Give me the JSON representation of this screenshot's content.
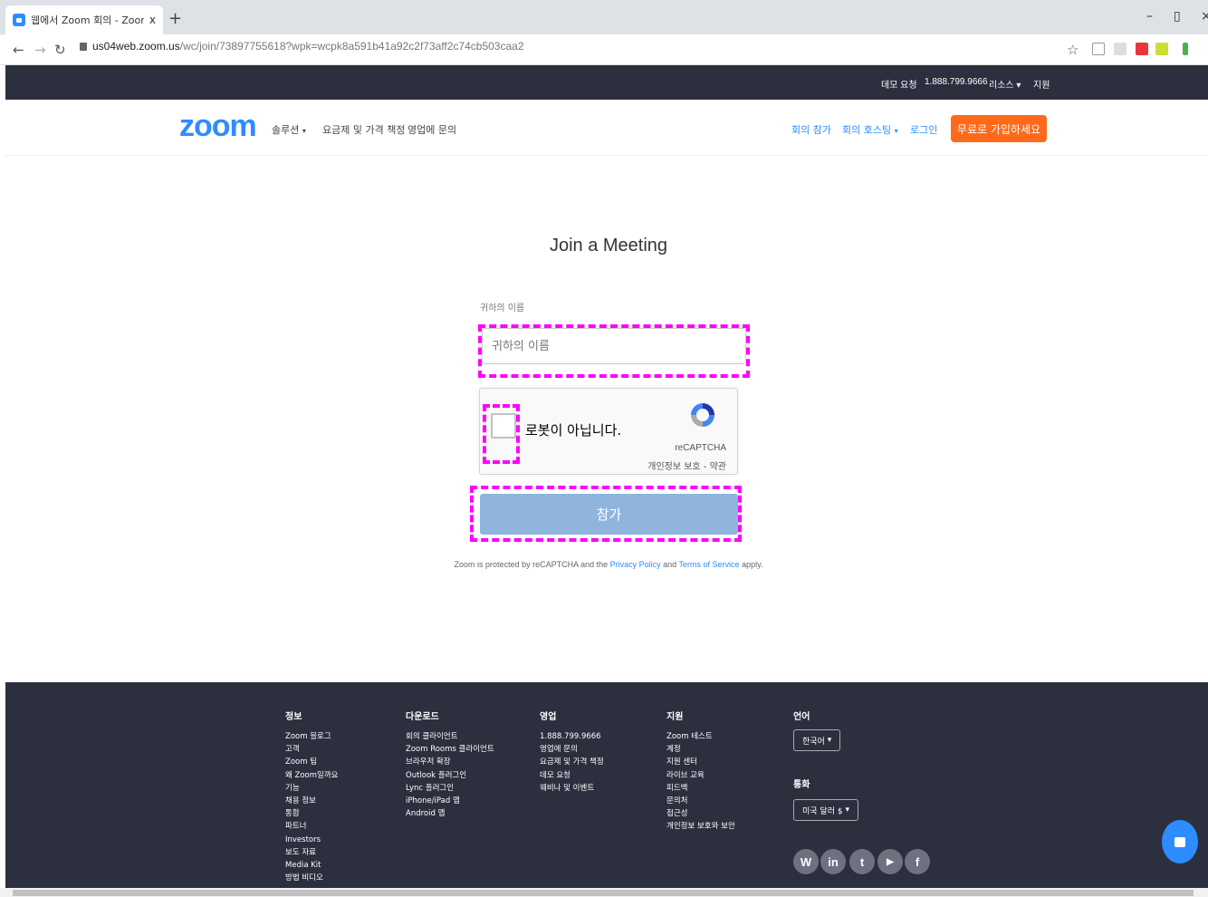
{
  "browser": {
    "tab_title": "웹에서 Zoom 회의 - Zoom",
    "tab_close": "x",
    "new_tab": "+",
    "url_host": "us04web.zoom.us",
    "url_path": "/wc/join/73897755618?wpk=wcpk8a591b41a92c2f73aff2c74cb503caa2"
  },
  "topbar": {
    "demo": "데모 요청",
    "phone": "1.888.799.9666",
    "resources": "리소스",
    "support": "지원"
  },
  "header": {
    "logo": "zoom",
    "solutions": "솔루션",
    "pricing": "요금제 및 가격 책정",
    "sales": "영업에 문의",
    "join": "회의 참가",
    "host": "회의 호스팅",
    "login": "로그인",
    "signup": "무료로 가입하세요"
  },
  "form": {
    "title": "Join a Meeting",
    "name_label": "귀하의 이름",
    "name_placeholder": "귀하의 이름",
    "name_value": "",
    "captcha_text": "로봇이 아닙니다.",
    "captcha_brand": "reCAPTCHA",
    "captcha_links": "개인정보 보호 - 약관",
    "join_button": "참가",
    "legal_prefix": "Zoom is protected by reCAPTCHA and the",
    "privacy_link": "Privacy Policy",
    "legal_and": "and",
    "terms_link": "Terms of Service",
    "legal_suffix": "apply."
  },
  "footer": {
    "col1_title": "정보",
    "col1_items": [
      "Zoom 블로그",
      "고객",
      "Zoom 팀",
      "왜 Zoom일까요",
      "기능",
      "채용 정보",
      "통합",
      "파트너",
      "Investors",
      "보도 자료",
      "Media Kit",
      "방법 비디오"
    ],
    "col2_title": "다운로드",
    "col2_items": [
      "회의 클라이언트",
      "Zoom Rooms 클라이언트",
      "브라우저 확장",
      "Outlook 플러그인",
      "Lync 플러그인",
      "iPhone/iPad 앱",
      "Android 앱"
    ],
    "col3_title": "영업",
    "col3_items": [
      "1.888.799.9666",
      "영업에 문의",
      "요금제 및 가격 책정",
      "데모 요청",
      "웨비나 및 이벤트"
    ],
    "col4_title": "지원",
    "col4_items": [
      "Zoom 테스트",
      "계정",
      "지원 센터",
      "라이브 교육",
      "피드백",
      "문의처",
      "접근성",
      "개인정보 보호와 보안"
    ],
    "lang_title": "언어",
    "lang_value": "한국어",
    "currency_title": "통화",
    "currency_value": "미국 달러 $",
    "social": [
      "W",
      "in",
      "t",
      "▶",
      "f"
    ]
  }
}
